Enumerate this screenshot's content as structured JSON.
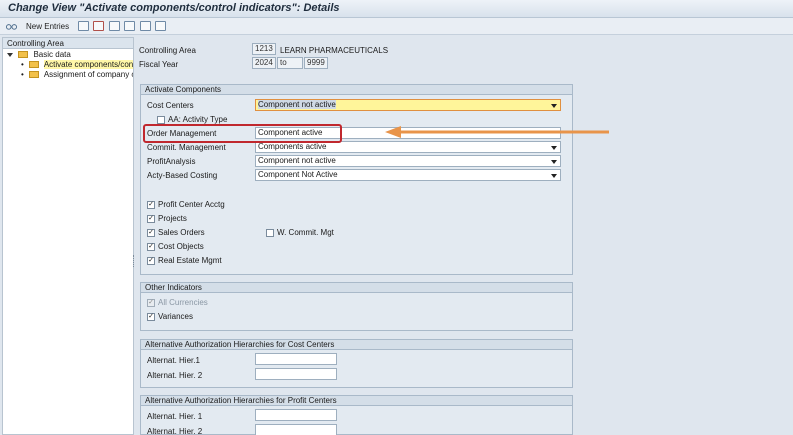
{
  "window": {
    "title": "Change View \"Activate components/control indicators\": Details"
  },
  "toolbar": {
    "new_entries_label": "New Entries",
    "icons": [
      "display-change-icon",
      "copy-icon",
      "delete-icon",
      "undo-icon",
      "select-all-icon",
      "previous-entry-icon",
      "next-entry-icon"
    ]
  },
  "tree": {
    "header": "Controlling Area",
    "items": [
      {
        "label": "Basic data"
      },
      {
        "label": "Activate components/control indicators"
      },
      {
        "label": "Assignment of company code(s)"
      }
    ]
  },
  "header_fields": {
    "controlling_area_label": "Controlling Area",
    "controlling_area_value": "1213",
    "controlling_area_name": "LEARN PHARMACEUTICALS",
    "fiscal_year_label": "Fiscal Year",
    "fiscal_year_from": "2024",
    "to_label": "to",
    "fiscal_year_to": "9999"
  },
  "activate_components": {
    "title": "Activate Components",
    "rows": [
      {
        "label": "Cost Centers",
        "value": "Component not active"
      },
      {
        "label": "Order Management",
        "value": "Component active"
      },
      {
        "label": "Commit. Management",
        "value": "Components active"
      },
      {
        "label": "ProfitAnalysis",
        "value": "Component not active"
      },
      {
        "label": "Acty-Based Costing",
        "value": "Component Not Active"
      }
    ],
    "aa_activity_type_label": "AA: Activity Type",
    "checkboxes": [
      {
        "label": "Profit Center Acctg",
        "checked": "✓"
      },
      {
        "label": "Projects",
        "checked": "✓"
      },
      {
        "label": "Sales Orders",
        "checked": "✓"
      },
      {
        "label": "Cost Objects",
        "checked": "✓"
      },
      {
        "label": "Real Estate Mgmt",
        "checked": "✓"
      }
    ],
    "w_commit_mgt_label": "W. Commit. Mgt"
  },
  "other_indicators": {
    "title": "Other Indicators",
    "all_currencies_label": "All Currencies",
    "variances_label": "Variances",
    "check_mark": "✓"
  },
  "alt_auth_cost_centers": {
    "title": "Alternative Authorization Hierarchies for Cost Centers",
    "hier1_label": "Alternat. Hier.1",
    "hier2_label": "Alternat. Hier. 2"
  },
  "alt_auth_profit_centers": {
    "title": "Alternative Authorization Hierarchies for Profit Centers",
    "hier1_label": "Alternat. Hier. 1",
    "hier2_label": "Alternat. Hier. 2"
  },
  "colors": {
    "highlight_box": "#c0282e",
    "arrow": "#e8944a",
    "focused_field": "#fff59a"
  }
}
